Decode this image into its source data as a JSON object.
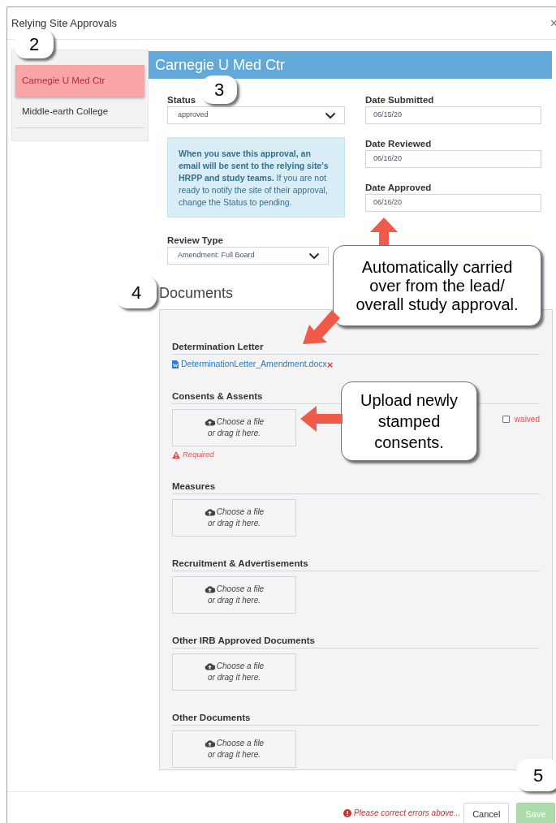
{
  "window": {
    "title": "Relying Site Approvals",
    "close": "×"
  },
  "sidebar": {
    "items": [
      {
        "label": "Carnegie U Med Ctr",
        "selected": true
      },
      {
        "label": "Middle-earth College",
        "selected": false
      }
    ]
  },
  "site": {
    "title": "Carnegie U Med Ctr"
  },
  "form": {
    "status": {
      "label": "Status",
      "value": "approved"
    },
    "info": "**When you save this approval, an email will be sent to the relying site's HRPP and study teams.** If you are not ready to notify the site of their approval, change the Status to pending.",
    "review_type": {
      "label": "Review Type",
      "value": "Amendment: Full Board"
    },
    "dates": [
      {
        "label": "Date Submitted",
        "value": "06/15/20"
      },
      {
        "label": "Date Reviewed",
        "value": "06/16/20"
      },
      {
        "label": "Date Approved",
        "value": "06/16/20"
      }
    ]
  },
  "documents": {
    "title": "Documents",
    "sections": [
      {
        "kind": "file",
        "heading": "Determination Letter",
        "file": "DeterminationLetter_Amendment.docx",
        "remove": "×"
      },
      {
        "kind": "upload",
        "heading": "Consents & Assents",
        "upload": [
          "Choose a file",
          "or drag it here."
        ],
        "waived": {
          "label": "waived",
          "checked": false
        },
        "required": "Required"
      },
      {
        "kind": "upload",
        "heading": "Measures",
        "upload": [
          "Choose a file",
          "or drag it here."
        ]
      },
      {
        "kind": "upload",
        "heading": "Recruitment & Advertisements",
        "upload": [
          "Choose a file",
          "or drag it here."
        ]
      },
      {
        "kind": "upload",
        "heading": "Other IRB Approved Documents",
        "upload": [
          "Choose a file",
          "or drag it here."
        ]
      },
      {
        "kind": "upload",
        "heading": "Other Documents",
        "upload": [
          "Choose a file",
          "or drag it here."
        ]
      }
    ]
  },
  "footer": {
    "error": "Please correct errors above...",
    "buttons": [
      {
        "label": "Cancel",
        "kind": "secondary",
        "disabled": false
      },
      {
        "label": "Save",
        "kind": "primary",
        "disabled": true
      }
    ]
  },
  "annotations": {
    "badges": [
      "2",
      "3",
      "4",
      "5"
    ],
    "callouts": [
      "Automatically carried over from the lead/ overall study approval.",
      "Upload newly stamped consents."
    ]
  }
}
